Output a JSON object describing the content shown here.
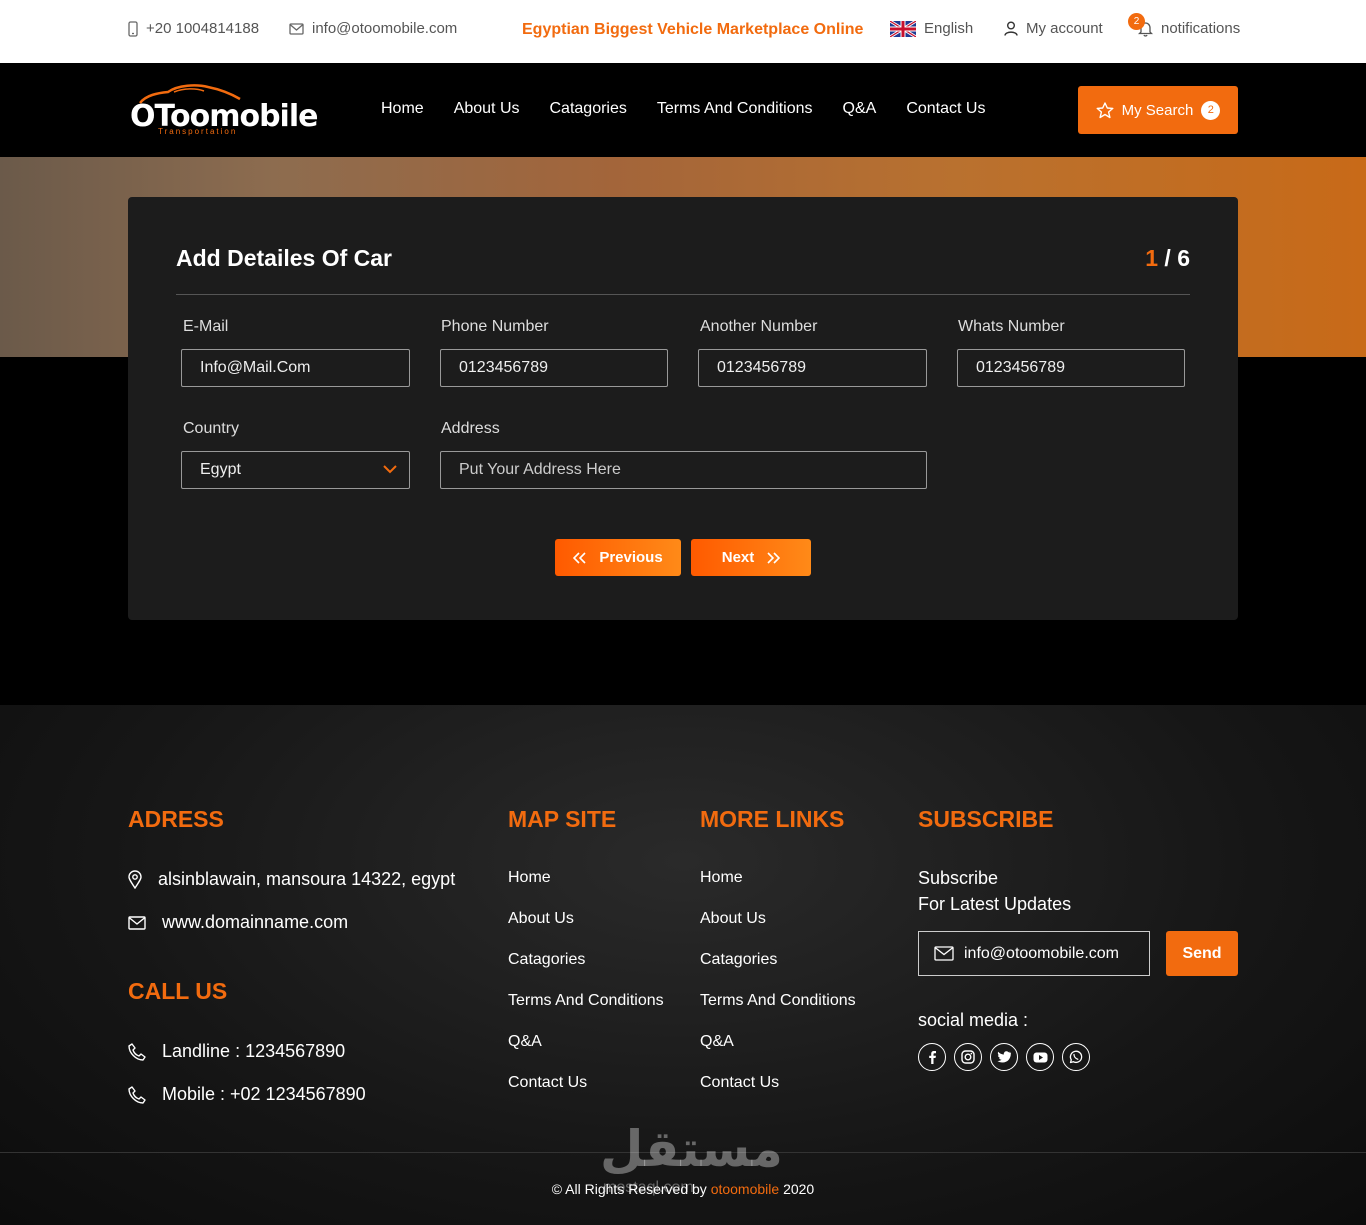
{
  "topbar": {
    "phone": "+20 1004814188",
    "email": "info@otoomobile.com",
    "tagline": "Egyptian Biggest Vehicle Marketplace Online",
    "language": "English",
    "account": "My account",
    "notifications": "notifications",
    "notifications_count": "2"
  },
  "navbar": {
    "logo_text": "OToomobile",
    "logo_sub": "Transportation",
    "links": [
      "Home",
      "About Us",
      "Catagories",
      "Terms And Conditions",
      "Q&A",
      "Contact Us"
    ],
    "my_search": "My Search",
    "my_search_count": "2"
  },
  "form": {
    "title": "Add Detailes Of Car",
    "step_current": "1",
    "step_total": " / 6",
    "email_label": "E-Mail",
    "email_value": "Info@Mail.Com",
    "phone_label": "Phone Number",
    "phone_value": "0123456789",
    "another_label": "Another Number",
    "another_value": "0123456789",
    "whats_label": "Whats Number",
    "whats_value": "0123456789",
    "country_label": "Country",
    "country_value": "Egypt",
    "address_label": "Address",
    "address_placeholder": "Put Your Address Here",
    "previous": "Previous",
    "next": "Next"
  },
  "footer": {
    "address_head": "ADRESS",
    "address": "alsinblawain, mansoura 14322, egypt",
    "website": "www.domainname.com",
    "call_head": "CALL US",
    "landline": "Landline : 1234567890",
    "mobile": "Mobile : +02 1234567890",
    "map_head": "MAP SITE",
    "map_links": [
      "Home",
      "About Us",
      "Catagories",
      "Terms And Conditions",
      "Q&A",
      "Contact Us"
    ],
    "more_head": "MORE LINKS",
    "more_links": [
      "Home",
      "About Us",
      "Catagories",
      "Terms And Conditions",
      "Q&A",
      "Contact Us"
    ],
    "subscribe_head": "SUBSCRIBE",
    "subscribe_line1": "Subscribe",
    "subscribe_line2": "For Latest Updates",
    "subscribe_email": "info@otoomobile.com",
    "send": "Send",
    "social_label": "social media :",
    "socials": [
      "facebook-icon",
      "instagram-icon",
      "twitter-icon",
      "youtube-icon",
      "whatsapp-icon"
    ],
    "copyright_prefix": "© All Rights Reserved by ",
    "copyright_brand": "otoomobile",
    "copyright_year": " 2020",
    "watermark": "مستقل",
    "watermark_sub": "mostaql.com"
  },
  "colors": {
    "accent": "#f26b0f",
    "card": "#1c1c1c"
  }
}
